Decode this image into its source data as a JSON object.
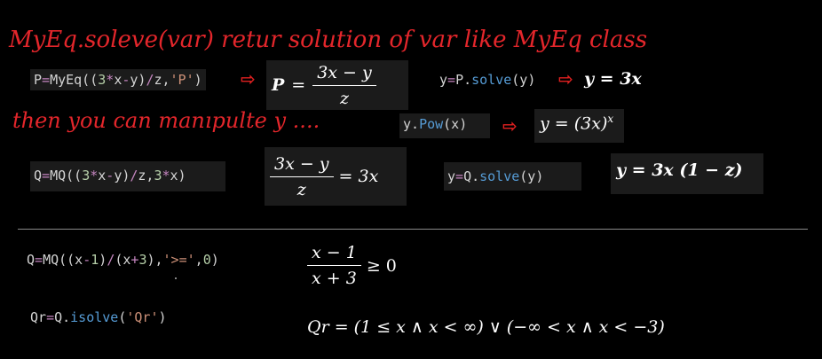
{
  "title": "MyEq.soleve(var) retur solution of var like MyEq class",
  "note": "then you can manıpulte y ....",
  "row1": {
    "code_prefix": "P",
    "code_eq": "=",
    "code_call": "MyEq((",
    "code_3": "3",
    "code_star": "*",
    "code_x": "x",
    "code_minus": "-",
    "code_y": "y)",
    "code_div": "/",
    "code_z": "z,",
    "code_str": "'P'",
    "code_close": ")",
    "math_lhs": "P",
    "math_eq": "=",
    "math_num": "3x − y",
    "math_den": "z",
    "solve_y": "y",
    "solve_eq": "=",
    "solve_obj": "P.",
    "solve_fn": "solve",
    "solve_arg": "(y)",
    "result": "y = 3x"
  },
  "row2": {
    "code_y": "y.",
    "code_fn": "Pow",
    "code_arg": "(x)",
    "result_base": "y = (3x)",
    "result_exp": "x"
  },
  "row3": {
    "code_prefix": "Q",
    "code_eq": "=",
    "code_call": "MQ((",
    "code_3": "3",
    "code_star": "*",
    "code_x": "x",
    "code_minus": "-",
    "code_y": "y)",
    "code_div": "/",
    "code_z": "z,",
    "code_3b": "3",
    "code_star2": "*",
    "code_xend": "x)",
    "math_num": "3x − y",
    "math_den": "z",
    "math_rhs": "= 3x",
    "solve_y": "y",
    "solve_eq": "=",
    "solve_obj": "Q.",
    "solve_fn": "solve",
    "solve_arg": "(y)",
    "result": "y = 3x (1 − z)"
  },
  "row4": {
    "code_prefix": "Q",
    "code_eq": "=",
    "code_call": "MQ((x",
    "code_minus": "-",
    "code_1": "1",
    "code_close1": ")",
    "code_div": "/",
    "code_open": "(x",
    "code_plus": "+",
    "code_3": "3",
    "code_close2": "),",
    "code_str": "'>='",
    "code_comma": ",",
    "code_0": "0",
    "code_end": ")",
    "math_num": "x − 1",
    "math_den": "x + 3",
    "math_rhs": "≥ 0"
  },
  "row5": {
    "code_prefix": "Qr",
    "code_eq": "=",
    "code_obj": "Q.",
    "code_fn": "isolve",
    "code_open": "(",
    "code_str": "'Qr'",
    "code_close": ")",
    "result": "Qr = (1 ≤ x ∧ x < ∞) ∨ (−∞ < x ∧ x < −3)"
  },
  "colors": {
    "background": "#000000",
    "handwriting": "#e3262b",
    "arrow": "#e02020",
    "code_text": "#d4d4d4",
    "code_operator": "#c586c0",
    "code_number": "#b5cea8",
    "code_string": "#ce9178",
    "code_method": "#569cd6",
    "code_box": "#1b1b1b"
  },
  "icons": [
    "arrow-right-icon"
  ]
}
